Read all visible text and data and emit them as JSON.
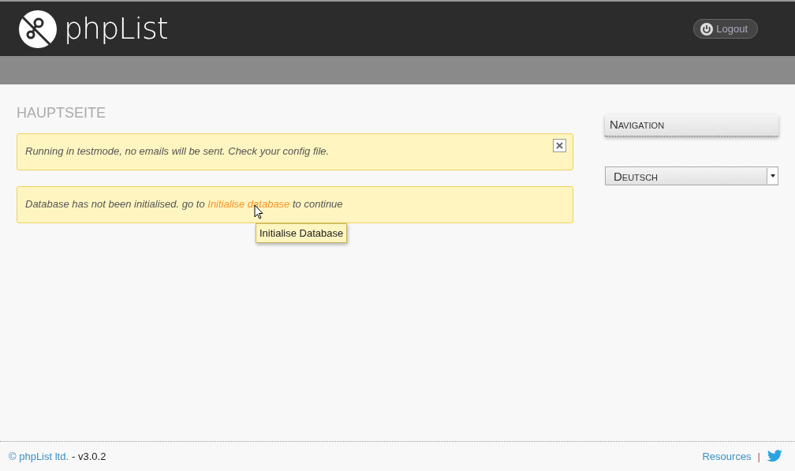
{
  "header": {
    "logo_text": "phpList",
    "logout": "Logout"
  },
  "page_title": "HAUPTSEITE",
  "alerts": [
    {
      "kind": "dismissable",
      "text": "Running in testmode, no emails will be sent. Check your config file."
    },
    {
      "kind": "link",
      "before": "Database has not been initialised. go to ",
      "link": "Initialise database",
      "after": " to continue",
      "tooltip": "Initialise Database"
    }
  ],
  "sidebar": {
    "navigation": "Navigation",
    "language": "Deutsch"
  },
  "footer": {
    "copyright": "© phpList ltd.",
    "version": "- v3.0.2",
    "resources": "Resources",
    "separator": "|"
  }
}
